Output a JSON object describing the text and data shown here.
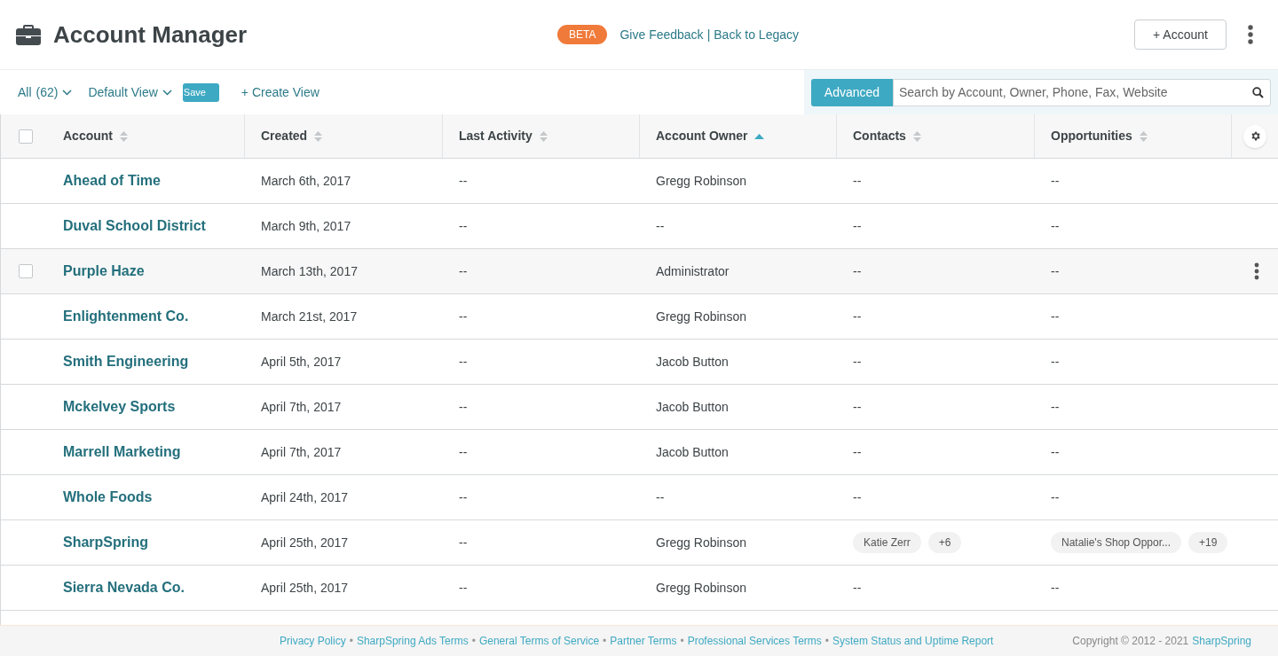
{
  "header": {
    "title": "Account Manager",
    "badge": "BETA",
    "feedback_link": "Give Feedback",
    "divider": "|",
    "legacy_link": "Back to Legacy",
    "add_button": "+ Account"
  },
  "toolbar": {
    "filter": "All",
    "filter_count": "(62)",
    "view": "Default View",
    "save_button": "Save",
    "create_view": "+ Create View",
    "advanced_button": "Advanced",
    "search": {
      "placeholder": "Search by Account, Owner, Phone, Fax, Website"
    }
  },
  "table": {
    "header_checked": false,
    "columns": [
      {
        "label": "Account",
        "sorted": false
      },
      {
        "label": "Created",
        "sorted": false
      },
      {
        "label": "Last Activity",
        "sorted": false
      },
      {
        "label": "Account Owner",
        "sorted": true
      },
      {
        "label": "Contacts",
        "sorted": false
      },
      {
        "label": "Opportunities",
        "sorted": false
      }
    ],
    "rows": [
      {
        "hovered": false,
        "checked": false,
        "account": "Ahead of Time",
        "created": "March 6th, 2017",
        "last_activity": "--",
        "owner": "Gregg Robinson",
        "contacts": "--",
        "opportunities": "--"
      },
      {
        "hovered": false,
        "checked": false,
        "account": "Duval School District",
        "created": "March 9th, 2017",
        "last_activity": "--",
        "owner": "--",
        "contacts": "--",
        "opportunities": "--"
      },
      {
        "hovered": true,
        "checked": false,
        "account": "Purple Haze",
        "created": "March 13th, 2017",
        "last_activity": "--",
        "owner": "Administrator",
        "contacts": "--",
        "opportunities": "--"
      },
      {
        "hovered": false,
        "checked": false,
        "account": "Enlightenment Co.",
        "created": "March 21st, 2017",
        "last_activity": "--",
        "owner": "Gregg Robinson",
        "contacts": "--",
        "opportunities": "--"
      },
      {
        "hovered": false,
        "checked": false,
        "account": "Smith Engineering",
        "created": "April 5th, 2017",
        "last_activity": "--",
        "owner": "Jacob Button",
        "contacts": "--",
        "opportunities": "--"
      },
      {
        "hovered": false,
        "checked": false,
        "account": "Mckelvey Sports",
        "created": "April 7th, 2017",
        "last_activity": "--",
        "owner": "Jacob Button",
        "contacts": "--",
        "opportunities": "--"
      },
      {
        "hovered": false,
        "checked": false,
        "account": "Marrell Marketing",
        "created": "April 7th, 2017",
        "last_activity": "--",
        "owner": "Jacob Button",
        "contacts": "--",
        "opportunities": "--"
      },
      {
        "hovered": false,
        "checked": false,
        "account": "Whole Foods",
        "created": "April 24th, 2017",
        "last_activity": "--",
        "owner": "--",
        "contacts": "--",
        "opportunities": "--"
      },
      {
        "hovered": false,
        "checked": false,
        "account": "SharpSpring",
        "created": "April 25th, 2017",
        "last_activity": "--",
        "owner": "Gregg Robinson",
        "contacts": [
          "Katie Zerr",
          "+6"
        ],
        "opportunities": [
          "Natalie's Shop Oppor...",
          "+19"
        ]
      },
      {
        "hovered": false,
        "checked": false,
        "account": "Sierra Nevada Co.",
        "created": "April 25th, 2017",
        "last_activity": "--",
        "owner": "Gregg Robinson",
        "contacts": "--",
        "opportunities": "--"
      }
    ]
  },
  "footer": {
    "links": [
      "Privacy Policy",
      "SharpSpring Ads Terms",
      "General Terms of Service",
      "Partner Terms",
      "Professional Services Terms",
      "System Status and Uptime Report"
    ],
    "separator": "•",
    "copyright": "Copyright © 2012 - 2021",
    "brand_link": "SharpSpring"
  }
}
